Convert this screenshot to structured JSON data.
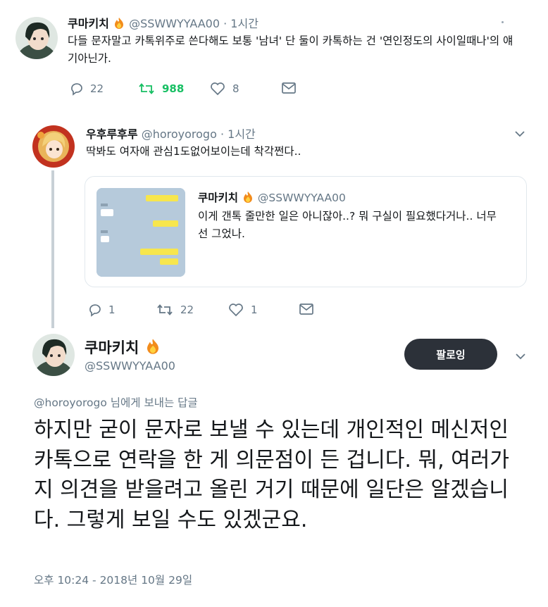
{
  "tweet1": {
    "display_name": "쿠마키치",
    "handle": "@SSWWYYAA00",
    "time": "· 1시간",
    "text": "다들 문자말고 카톡위주로 쓴다해도 보통 '남녀' 단 둘이 카톡하는 건 '연인정도의 사이일때나'의 얘기아닌가.",
    "stats": {
      "replies": "22",
      "retweets": "988",
      "likes": "8"
    }
  },
  "tweet2": {
    "display_name": "우후루후루",
    "handle": "@horoyorogo",
    "time": "· 1시간",
    "text": "딱봐도 여자애 관심1도없어보이는데 착각쩐다..",
    "quoted": {
      "display_name": "쿠마키치",
      "handle": "@SSWWYYAA00",
      "text": "이게 갠톡 줄만한 일은 아니잖아..? 뭐 구실이 필요했다거나.. 너무 선 그었나."
    },
    "stats": {
      "replies": "1",
      "retweets": "22",
      "likes": "1"
    }
  },
  "main_tweet": {
    "display_name": "쿠마키치",
    "handle": "@SSWWYYAA00",
    "follow_label": "팔로잉",
    "replying_handle": "@horoyorogo",
    "replying_suffix": " 님에게 보내는 답글",
    "text": "하지만 굳이 문자로 보낼 수 있는데 개인적인 메신저인 카톡으로 연락을 한 게 의문점이 든 겁니다. 뭐, 여러가지 의견을 받을려고 올린 거기 때문에 일단은 알겠습니다. 그렇게 보일 수도 있겠군요.",
    "timestamp": "오후 10:24 - 2018년 10월 29일"
  },
  "icons": {
    "reply": "reply-icon",
    "retweet": "retweet-icon",
    "like": "heart-icon",
    "dm": "envelope-icon",
    "caret": "chevron-down-icon",
    "emoji": "fire-emoji"
  },
  "colors": {
    "retweet_active": "#17bf63",
    "muted": "#657786",
    "follow_button_bg": "#2c3139"
  }
}
